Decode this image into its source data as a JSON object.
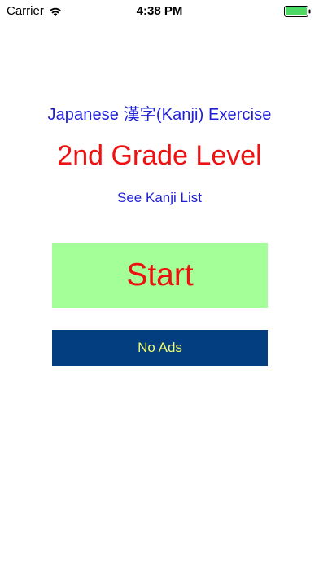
{
  "status_bar": {
    "carrier": "Carrier",
    "time": "4:38 PM",
    "wifi_icon": "wifi-icon",
    "battery_icon": "battery-icon",
    "battery_color": "#4cd964"
  },
  "main": {
    "title": "Japanese 漢字(Kanji) Exercise",
    "level": "2nd Grade Level",
    "kanji_list_link": "See Kanji List",
    "start_label": "Start",
    "no_ads_label": "No Ads"
  },
  "colors": {
    "title": "#1f1fd8",
    "level": "#ee1111",
    "start_bg": "#a4ff98",
    "start_text": "#ee1111",
    "no_ads_bg": "#033f80",
    "no_ads_text": "#f2ff6e"
  }
}
